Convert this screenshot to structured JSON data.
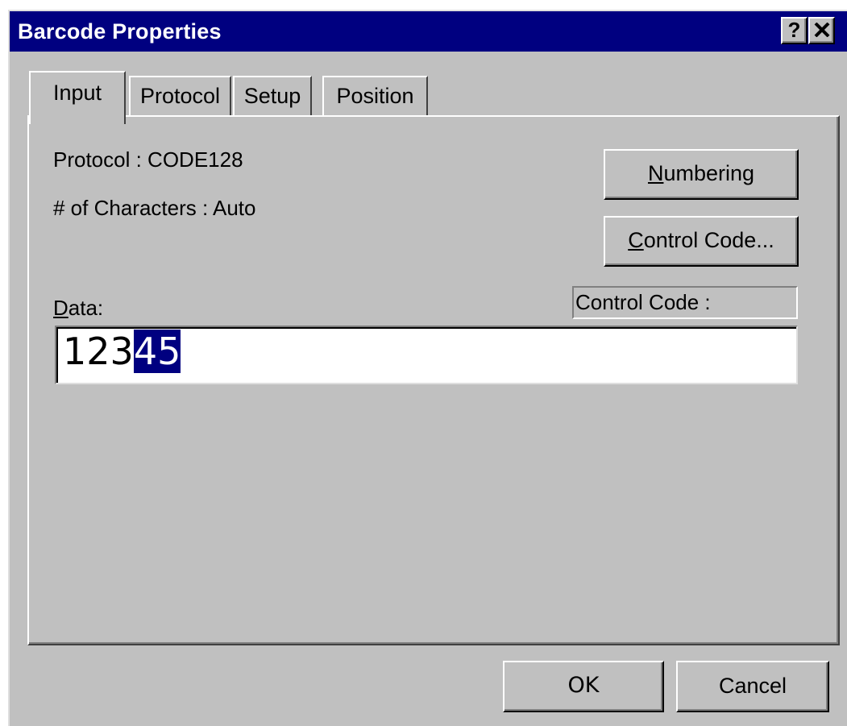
{
  "window": {
    "title": "Barcode Properties",
    "help_label": "?",
    "close_icon": "close-icon"
  },
  "tabs": [
    {
      "label": "Input",
      "active": true
    },
    {
      "label": "Protocol",
      "active": false
    },
    {
      "label": "Setup",
      "active": false
    },
    {
      "label": "Position",
      "active": false
    }
  ],
  "input_tab": {
    "protocol_text": "Protocol : CODE128",
    "characters_text": "# of Characters : Auto",
    "numbering_button": {
      "mnemonic": "N",
      "rest": "umbering"
    },
    "control_code_button": {
      "mnemonic": "C",
      "rest": "ontrol Code..."
    },
    "data_label": {
      "mnemonic": "D",
      "rest": "ata:"
    },
    "control_code_display": "Control Code :",
    "data_value": {
      "unselected": "123",
      "selected": "45"
    }
  },
  "footer": {
    "ok_label": "OK",
    "cancel_label": "Cancel"
  },
  "colors": {
    "titlebar": "#000080",
    "face": "#c0c0c0",
    "selection": "#000080"
  }
}
